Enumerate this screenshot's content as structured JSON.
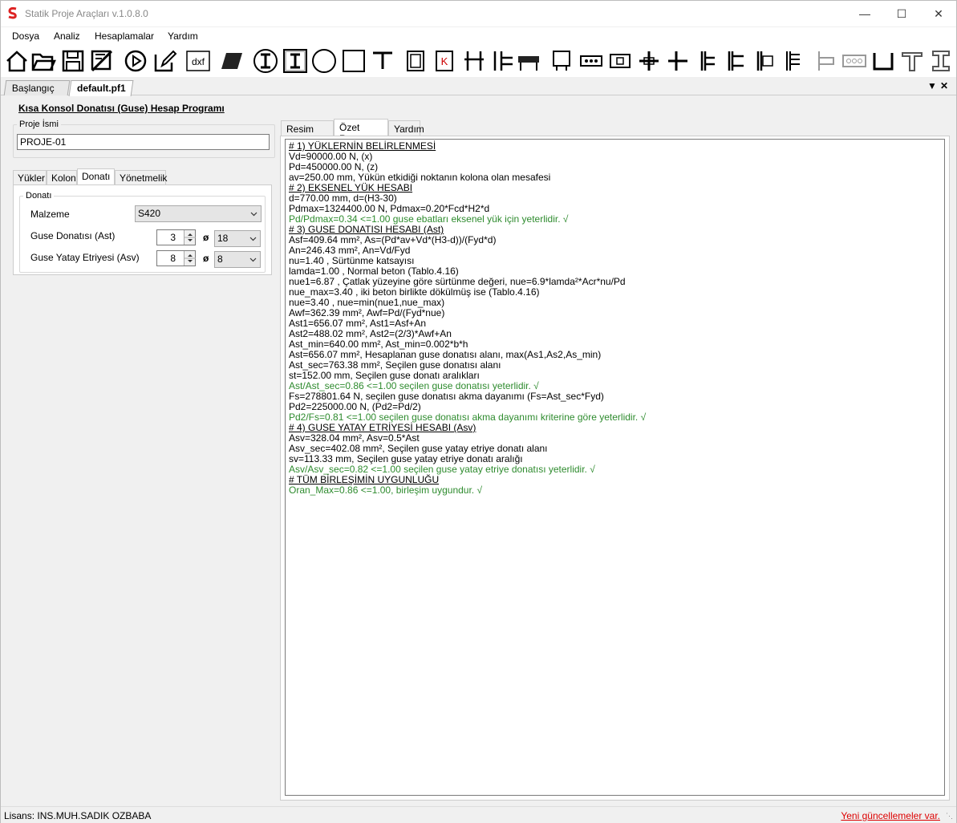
{
  "window": {
    "title": "Statik Proje Araçları v.1.0.8.0"
  },
  "menu": [
    "Dosya",
    "Analiz",
    "Hesaplamalar",
    "Yardım"
  ],
  "toolbar_icons": [
    "home-icon",
    "open-folder-icon",
    "save-icon",
    "grid-save-icon",
    "play-icon",
    "edit-icon",
    "dxf-icon",
    "slab-icon",
    "i-beam-circle-icon",
    "i-beam-square-icon",
    "circle-section-icon",
    "square-section-icon",
    "t-section-icon",
    "column-icon",
    "column-k-icon",
    "frame-icon",
    "beam-column-icon",
    "beam-icon",
    "pile-cap-icon",
    "footing-icon",
    "column-footing-icon",
    "connection-icon",
    "connection2-icon",
    "connection3-icon",
    "connection4-icon",
    "connection5-icon",
    "connection6-icon",
    "bracket-icon",
    "bolt-row-icon",
    "u-section-icon",
    "t-shape-icon",
    "i-shape-icon"
  ],
  "doc_tabs": [
    "Başlangıç",
    "default.pf1"
  ],
  "heading": "Kısa Konsol Donatısı (Guse) Hesap Programı",
  "project": {
    "label": "Proje İsmi",
    "value": "PROJE-01"
  },
  "left_tabs": [
    "Yükler",
    "Kolon",
    "Donatı",
    "Yönetmelik"
  ],
  "donati": {
    "group": "Donatı",
    "malzeme_label": "Malzeme",
    "malzeme_value": "S420",
    "ast_label": "Guse Donatısı (Ast)",
    "ast_count": "3",
    "ast_dia": "18",
    "asv_label": "Guse Yatay Etriyesi (Asv)",
    "asv_count": "8",
    "asv_dia": "8",
    "phi": "ø"
  },
  "right_tabs": [
    "Resim WPF",
    "Özet Rapor",
    "Yardım"
  ],
  "report": [
    {
      "t": "# 1) YÜKLERNİN BELİRLENMESİ",
      "s": "h"
    },
    {
      "t": "Vd=90000.00 N, (x)",
      "s": ""
    },
    {
      "t": "Pd=450000.00 N, (z)",
      "s": ""
    },
    {
      "t": "av=250.00 mm, Yükün etkidiği noktanın kolona olan mesafesi",
      "s": ""
    },
    {
      "t": "# 2) EKSENEL YÜK HESABI",
      "s": "h"
    },
    {
      "t": "d=770.00 mm, d=(H3-30)",
      "s": ""
    },
    {
      "t": "Pdmax=1324400.00 N, Pdmax=0.20*Fcd*H2*d",
      "s": ""
    },
    {
      "t": "Pd/Pdmax=0.34 <=1.00 guse ebatları eksenel yük için yeterlidir. √",
      "s": "g"
    },
    {
      "t": "# 3) GUSE DONATISI HESABI (Ast)",
      "s": "h"
    },
    {
      "t": "Asf=409.64 mm², As=(Pd*av+Vd*(H3-d))/(Fyd*d)",
      "s": ""
    },
    {
      "t": "An=246.43 mm², An=Vd/Fyd",
      "s": ""
    },
    {
      "t": "nu=1.40 , Sürtünme katsayısı",
      "s": ""
    },
    {
      "t": "lamda=1.00 , Normal beton (Tablo.4.16)",
      "s": ""
    },
    {
      "t": "nue1=6.87 , Çatlak yüzeyine göre sürtünme değeri, nue=6.9*lamda²*Acr*nu/Pd",
      "s": ""
    },
    {
      "t": "nue_max=3.40 , iki beton birlikte dökülmüş ise (Tablo.4.16)",
      "s": ""
    },
    {
      "t": "nue=3.40 , nue=min(nue1,nue_max)",
      "s": ""
    },
    {
      "t": "Awf=362.39 mm², Awf=Pd/(Fyd*nue)",
      "s": ""
    },
    {
      "t": "Ast1=656.07 mm², Ast1=Asf+An",
      "s": ""
    },
    {
      "t": "Ast2=488.02 mm², Ast2=(2/3)*Awf+An",
      "s": ""
    },
    {
      "t": "Ast_min=640.00 mm², Ast_min=0.002*b*h",
      "s": ""
    },
    {
      "t": "Ast=656.07 mm², Hesaplanan guse donatısı alanı, max(As1,As2,As_min)",
      "s": ""
    },
    {
      "t": "Ast_sec=763.38 mm², Seçilen guse donatısı alanı",
      "s": ""
    },
    {
      "t": "st=152.00 mm, Seçilen guse donatı aralıkları",
      "s": ""
    },
    {
      "t": "Ast/Ast_sec=0.86 <=1.00 seçilen guse donatısı yeterlidir. √",
      "s": "g"
    },
    {
      "t": "Fs=278801.64 N, seçilen guse donatısı akma dayanımı (Fs=Ast_sec*Fyd)",
      "s": ""
    },
    {
      "t": "Pd2=225000.00 N, (Pd2=Pd/2)",
      "s": ""
    },
    {
      "t": "Pd2/Fs=0.81 <=1.00 seçilen guse donatısı akma dayanımı kriterine göre yeterlidir. √",
      "s": "g"
    },
    {
      "t": "# 4) GUSE YATAY ETRİYESİ HESABI (Asv)",
      "s": "h"
    },
    {
      "t": "Asv=328.04 mm², Asv=0.5*Ast",
      "s": ""
    },
    {
      "t": "Asv_sec=402.08 mm², Seçilen guse yatay etriye donatı alanı",
      "s": ""
    },
    {
      "t": "sv=113.33 mm, Seçilen guse yatay etriye donatı aralığı",
      "s": ""
    },
    {
      "t": "Asv/Asv_sec=0.82 <=1.00 seçilen guse yatay etriye donatısı yeterlidir. √",
      "s": "g"
    },
    {
      "t": "# TÜM BİRLEŞİMİN UYGUNLUĞU",
      "s": "h"
    },
    {
      "t": "Oran_Max=0.86 <=1.00, birleşim uygundur. √",
      "s": "g"
    }
  ],
  "status": {
    "license": "Lisans: INS.MUH.SADIK OZBABA",
    "update": "Yeni güncellemeler var."
  }
}
